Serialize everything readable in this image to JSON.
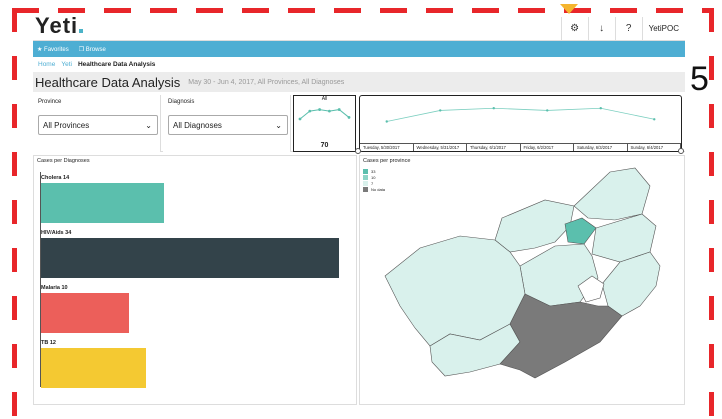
{
  "header": {
    "logo": "Yeti",
    "user": "YetiPOC",
    "icons": [
      "gear-icon",
      "download-icon",
      "help-icon"
    ]
  },
  "nav": {
    "favorites": "★ Favorites",
    "browse": "❐ Browse"
  },
  "breadcrumb": {
    "home": "Home",
    "yeti": "Yeti",
    "current": "Healthcare Data Analysis"
  },
  "page": {
    "title": "Healthcare Data Analysis",
    "subtitle": "May 30 - Jun 4, 2017, All Provinces, All Diagnoses"
  },
  "filters": {
    "province": {
      "label": "Province",
      "value": "All Provinces"
    },
    "diagnosis": {
      "label": "Diagnosis",
      "value": "All Diagnoses"
    }
  },
  "mini_chart": {
    "label": "All",
    "total": "70",
    "values": [
      7,
      12,
      13,
      12,
      13,
      8
    ]
  },
  "overlay": {
    "annotation": "5"
  },
  "timeline": {
    "dates": [
      "Tuesday, 5/30/2017",
      "Wednesday, 5/31/2017",
      "Thursday, 6/1/2017",
      "Friday, 6/2/2017",
      "Saturday, 6/3/2017",
      "Sunday, 6/4/2017"
    ],
    "values": [
      7,
      12,
      13,
      12,
      13,
      8
    ]
  },
  "chart_data": {
    "type": "bar",
    "title": "Cases per Diagnoses",
    "categories": [
      "Cholera",
      "HIV/Aids",
      "Malaria",
      "TB"
    ],
    "values": [
      14,
      34,
      10,
      12
    ],
    "labels": [
      "Cholera 14",
      "HIV/Aids 34",
      "Malaria 10",
      "TB 12"
    ],
    "colors": [
      "#5bbfad",
      "#33434a",
      "#ec5f5a",
      "#f4c932"
    ]
  },
  "map": {
    "title": "Cases per province",
    "legend": [
      {
        "label": "33",
        "color": "#5bbfad"
      },
      {
        "label": "10",
        "color": "#8dd4c6"
      },
      {
        "label": "7",
        "color": "#d9f1ec"
      },
      {
        "label": "No data",
        "color": "#7a7a7a"
      }
    ]
  }
}
